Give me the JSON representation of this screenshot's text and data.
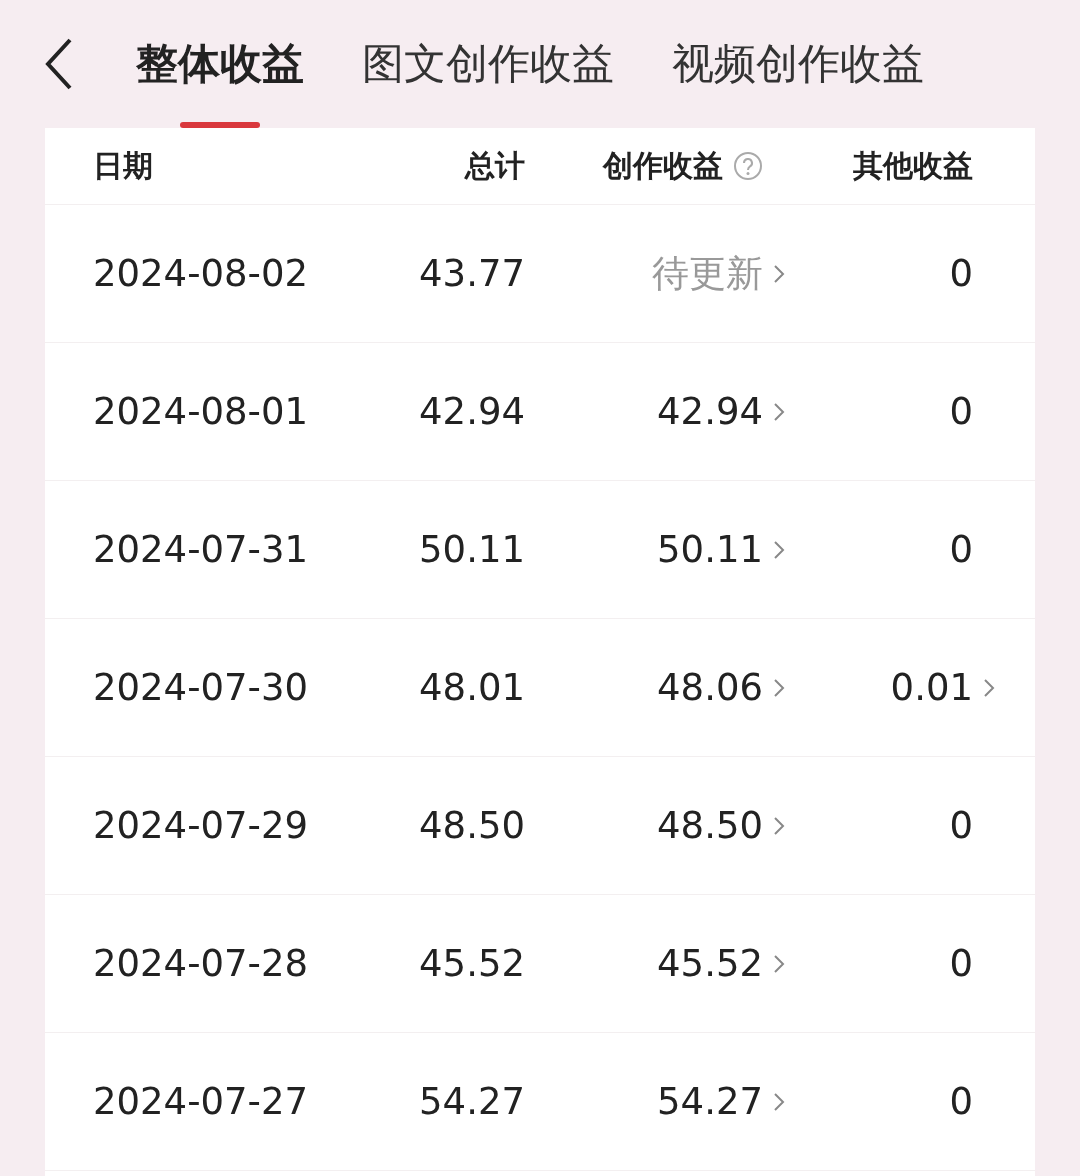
{
  "tabs": [
    {
      "label": "整体收益",
      "selected": true
    },
    {
      "label": "图文创作收益",
      "selected": false
    },
    {
      "label": "视频创作收益",
      "selected": false
    }
  ],
  "table": {
    "columns": [
      {
        "label": "日期",
        "help": false
      },
      {
        "label": "总计",
        "help": false
      },
      {
        "label": "创作收益",
        "help": true
      },
      {
        "label": "其他收益",
        "help": false
      }
    ],
    "rows": [
      {
        "date": "2024-08-02",
        "total": "43.77",
        "creation": {
          "value": "待更新",
          "pending": true,
          "link": true
        },
        "other": {
          "value": "0",
          "link": false
        }
      },
      {
        "date": "2024-08-01",
        "total": "42.94",
        "creation": {
          "value": "42.94",
          "pending": false,
          "link": true
        },
        "other": {
          "value": "0",
          "link": false
        }
      },
      {
        "date": "2024-07-31",
        "total": "50.11",
        "creation": {
          "value": "50.11",
          "pending": false,
          "link": true
        },
        "other": {
          "value": "0",
          "link": false
        }
      },
      {
        "date": "2024-07-30",
        "total": "48.01",
        "creation": {
          "value": "48.06",
          "pending": false,
          "link": true
        },
        "other": {
          "value": "0.01",
          "link": true
        }
      },
      {
        "date": "2024-07-29",
        "total": "48.50",
        "creation": {
          "value": "48.50",
          "pending": false,
          "link": true
        },
        "other": {
          "value": "0",
          "link": false
        }
      },
      {
        "date": "2024-07-28",
        "total": "45.52",
        "creation": {
          "value": "45.52",
          "pending": false,
          "link": true
        },
        "other": {
          "value": "0",
          "link": false
        }
      },
      {
        "date": "2024-07-27",
        "total": "54.27",
        "creation": {
          "value": "54.27",
          "pending": false,
          "link": true
        },
        "other": {
          "value": "0",
          "link": false
        }
      }
    ]
  }
}
